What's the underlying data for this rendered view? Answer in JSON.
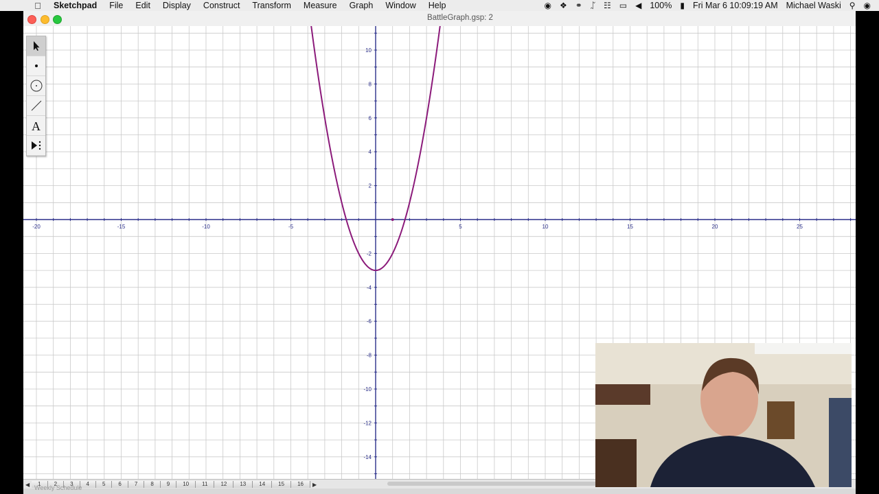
{
  "menubar": {
    "app_name": "Sketchpad",
    "menus": [
      "File",
      "Edit",
      "Display",
      "Construct",
      "Transform",
      "Measure",
      "Graph",
      "Window",
      "Help"
    ],
    "battery": "100%",
    "clock": "Fri Mar 6  10:09:19 AM",
    "user": "Michael Waski"
  },
  "window": {
    "title": "BattleGraph.gsp: 2"
  },
  "graph": {
    "x_range": [
      -20,
      28.5
    ],
    "y_range": [
      -15,
      11.5
    ],
    "x_tick_labels": [
      "-20",
      "-15",
      "-10",
      "-5",
      "5",
      "10",
      "15",
      "20",
      "25"
    ],
    "y_tick_labels": [
      "10",
      "8",
      "6",
      "4",
      "2",
      "-2",
      "-4",
      "-6",
      "-8",
      "-10",
      "-12",
      "-14"
    ],
    "function": "y = x^2 - 3",
    "curve_color": "#8b1a7a",
    "axis_color": "#2b2f8a",
    "grid_color": "#c9c9c9",
    "point_on_axis": [
      1,
      0
    ]
  },
  "toolbox": {
    "tools": [
      "arrow-tool-icon",
      "point-tool-icon",
      "compass-tool-icon",
      "straightedge-tool-icon",
      "text-tool-icon",
      "custom-tool-icon"
    ]
  },
  "page_tabs": [
    "1",
    "2",
    "3",
    "4",
    "5",
    "6",
    "7",
    "8",
    "9",
    "10",
    "11",
    "12",
    "13",
    "14",
    "15",
    "16"
  ],
  "footer_hint": "Weekly Schedule"
}
